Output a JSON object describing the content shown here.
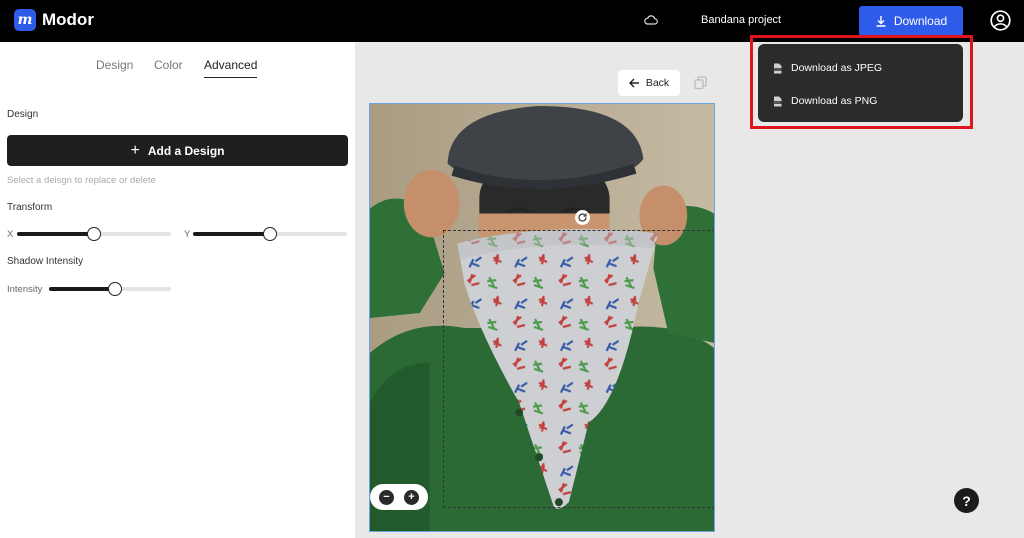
{
  "header": {
    "brand_mark": "m",
    "brand_name": "Modor",
    "project_name": "Bandana project",
    "download_label": "Download",
    "accent_color": "#2f5bea"
  },
  "download_menu": {
    "items": [
      {
        "label": "Download as JPEG",
        "icon": "jpeg-file-icon"
      },
      {
        "label": "Download as PNG",
        "icon": "png-file-icon"
      }
    ]
  },
  "left_panel": {
    "tabs": [
      {
        "label": "Design",
        "active": false
      },
      {
        "label": "Color",
        "active": false
      },
      {
        "label": "Advanced",
        "active": true
      }
    ],
    "design_section": {
      "label": "Design",
      "add_button": "Add a Design",
      "hint": "Select a deisgn to replace or delete"
    },
    "transform": {
      "label": "Transform",
      "x_label": "X",
      "x_value": 0.5,
      "y_label": "Y",
      "y_value": 0.5
    },
    "shadow": {
      "label": "Shadow Intensity",
      "intensity_label": "Intensity",
      "intensity_value": 0.54
    }
  },
  "canvas": {
    "back_label": "Back",
    "zoom_out": "−",
    "zoom_in": "+",
    "help": "?"
  }
}
